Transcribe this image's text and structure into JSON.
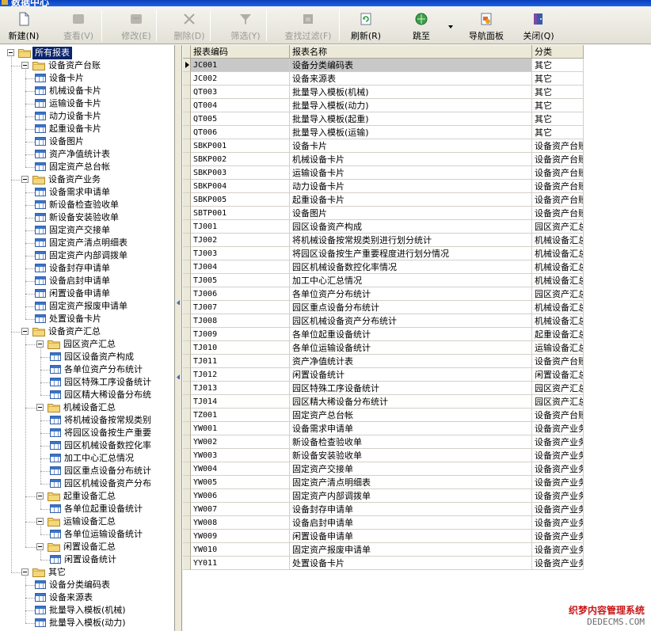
{
  "window": {
    "title": "数据中心"
  },
  "toolbar": {
    "buttons": [
      {
        "label": "新建(N)",
        "icon": "new-document-icon",
        "enabled": true
      },
      {
        "label": "查看(V)",
        "icon": "view-icon",
        "enabled": false
      },
      {
        "label": "修改(E)",
        "icon": "edit-icon",
        "enabled": false
      },
      {
        "label": "删除(D)",
        "icon": "delete-x-icon",
        "enabled": false
      },
      {
        "label": "筛选(Y)",
        "icon": "filter-funnel-icon",
        "enabled": false
      },
      {
        "label": "查找过滤(F)",
        "icon": "find-filter-icon",
        "enabled": false
      },
      {
        "label": "刷新(R)",
        "icon": "refresh-icon",
        "enabled": true
      },
      {
        "label": "跳至",
        "icon": "go-to-globe-icon",
        "enabled": true
      },
      {
        "label": "导航面板",
        "icon": "navigation-panel-icon",
        "enabled": true
      },
      {
        "label": "关闭(Q)",
        "icon": "close-door-icon",
        "enabled": true
      }
    ]
  },
  "tree": {
    "nodes": [
      {
        "label": "所有报表",
        "type": "root",
        "level": 0,
        "selected": true
      },
      {
        "label": "设备资产台账",
        "type": "folder",
        "level": 1
      },
      {
        "label": "设备卡片",
        "type": "report",
        "level": 2
      },
      {
        "label": "机械设备卡片",
        "type": "report",
        "level": 2
      },
      {
        "label": "运输设备卡片",
        "type": "report",
        "level": 2
      },
      {
        "label": "动力设备卡片",
        "type": "report",
        "level": 2
      },
      {
        "label": "起重设备卡片",
        "type": "report",
        "level": 2
      },
      {
        "label": "设备图片",
        "type": "report",
        "level": 2
      },
      {
        "label": "资产净值统计表",
        "type": "report",
        "level": 2
      },
      {
        "label": "固定资产总台帐",
        "type": "report",
        "level": 2
      },
      {
        "label": "设备资产业务",
        "type": "folder",
        "level": 1
      },
      {
        "label": "设备需求申请单",
        "type": "report",
        "level": 2
      },
      {
        "label": "新设备检查验收单",
        "type": "report",
        "level": 2
      },
      {
        "label": "新设备安装验收单",
        "type": "report",
        "level": 2
      },
      {
        "label": "固定资产交接单",
        "type": "report",
        "level": 2
      },
      {
        "label": "固定资产清点明细表",
        "type": "report",
        "level": 2
      },
      {
        "label": "固定资产内部调拨单",
        "type": "report",
        "level": 2
      },
      {
        "label": "设备封存申请单",
        "type": "report",
        "level": 2
      },
      {
        "label": "设备启封申请单",
        "type": "report",
        "level": 2
      },
      {
        "label": "闲置设备申请单",
        "type": "report",
        "level": 2
      },
      {
        "label": "固定资产报废申请单",
        "type": "report",
        "level": 2
      },
      {
        "label": "处置设备卡片",
        "type": "report",
        "level": 2
      },
      {
        "label": "设备资产汇总",
        "type": "folder",
        "level": 1
      },
      {
        "label": "园区资产汇总",
        "type": "folder",
        "level": 2
      },
      {
        "label": "园区设备资产构成",
        "type": "report",
        "level": 3
      },
      {
        "label": "各单位资产分布统计",
        "type": "report",
        "level": 3
      },
      {
        "label": "园区特殊工序设备统计",
        "type": "report",
        "level": 3
      },
      {
        "label": "园区精大稀设备分布统",
        "type": "report",
        "level": 3
      },
      {
        "label": "机械设备汇总",
        "type": "folder",
        "level": 2
      },
      {
        "label": "将机械设备按常规类别",
        "type": "report",
        "level": 3
      },
      {
        "label": "将园区设备按生产重要",
        "type": "report",
        "level": 3
      },
      {
        "label": "园区机械设备数控化率",
        "type": "report",
        "level": 3
      },
      {
        "label": "加工中心汇总情况",
        "type": "report",
        "level": 3
      },
      {
        "label": "园区重点设备分布统计",
        "type": "report",
        "level": 3
      },
      {
        "label": "园区机械设备资产分布",
        "type": "report",
        "level": 3
      },
      {
        "label": "起重设备汇总",
        "type": "folder",
        "level": 2
      },
      {
        "label": "各单位起重设备统计",
        "type": "report",
        "level": 3
      },
      {
        "label": "运输设备汇总",
        "type": "folder",
        "level": 2
      },
      {
        "label": "各单位运输设备统计",
        "type": "report",
        "level": 3
      },
      {
        "label": "闲置设备汇总",
        "type": "folder",
        "level": 2
      },
      {
        "label": "闲置设备统计",
        "type": "report",
        "level": 3
      },
      {
        "label": "其它",
        "type": "folder",
        "level": 1
      },
      {
        "label": "设备分类编码表",
        "type": "report",
        "level": 2
      },
      {
        "label": "设备来源表",
        "type": "report",
        "level": 2
      },
      {
        "label": "批量导入模板(机械)",
        "type": "report",
        "level": 2
      },
      {
        "label": "批量导入模板(动力)",
        "type": "report",
        "level": 2
      }
    ]
  },
  "grid": {
    "columns": [
      "报表编码",
      "报表名称",
      "分类"
    ],
    "rows": [
      {
        "code": "JC001",
        "name": "设备分类编码表",
        "category": "其它",
        "selected": true
      },
      {
        "code": "JC002",
        "name": "设备来源表",
        "category": "其它"
      },
      {
        "code": "QT003",
        "name": "批量导入模板(机械)",
        "category": "其它"
      },
      {
        "code": "QT004",
        "name": "批量导入模板(动力)",
        "category": "其它"
      },
      {
        "code": "QT005",
        "name": "批量导入模板(起重)",
        "category": "其它"
      },
      {
        "code": "QT006",
        "name": "批量导入模板(运输)",
        "category": "其它"
      },
      {
        "code": "SBKP001",
        "name": "设备卡片",
        "category": "设备资产台账"
      },
      {
        "code": "SBKP002",
        "name": "机械设备卡片",
        "category": "设备资产台账"
      },
      {
        "code": "SBKP003",
        "name": "运输设备卡片",
        "category": "设备资产台账"
      },
      {
        "code": "SBKP004",
        "name": "动力设备卡片",
        "category": "设备资产台账"
      },
      {
        "code": "SBKP005",
        "name": "起重设备卡片",
        "category": "设备资产台账"
      },
      {
        "code": "SBTP001",
        "name": "设备图片",
        "category": "设备资产台账"
      },
      {
        "code": "TJ001",
        "name": "园区设备资产构成",
        "category": "园区资产汇总"
      },
      {
        "code": "TJ002",
        "name": "将机械设备按常规类别进行划分统计",
        "category": "机械设备汇总"
      },
      {
        "code": "TJ003",
        "name": "将园区设备按生产重要程度进行划分情况",
        "category": "机械设备汇总"
      },
      {
        "code": "TJ004",
        "name": "园区机械设备数控化率情况",
        "category": "机械设备汇总"
      },
      {
        "code": "TJ005",
        "name": "加工中心汇总情况",
        "category": "机械设备汇总"
      },
      {
        "code": "TJ006",
        "name": "各单位资产分布统计",
        "category": "园区资产汇总"
      },
      {
        "code": "TJ007",
        "name": "园区重点设备分布统计",
        "category": "机械设备汇总"
      },
      {
        "code": "TJ008",
        "name": "园区机械设备资产分布统计",
        "category": "机械设备汇总"
      },
      {
        "code": "TJ009",
        "name": "各单位起重设备统计",
        "category": "起重设备汇总"
      },
      {
        "code": "TJ010",
        "name": "各单位运输设备统计",
        "category": "运输设备汇总"
      },
      {
        "code": "TJ011",
        "name": "资产净值统计表",
        "category": "设备资产台账"
      },
      {
        "code": "TJ012",
        "name": "闲置设备统计",
        "category": "闲置设备汇总"
      },
      {
        "code": "TJ013",
        "name": "园区特殊工序设备统计",
        "category": "园区资产汇总"
      },
      {
        "code": "TJ014",
        "name": "园区精大稀设备分布统计",
        "category": "园区资产汇总"
      },
      {
        "code": "TZ001",
        "name": "固定资产总台帐",
        "category": "设备资产台账"
      },
      {
        "code": "YW001",
        "name": "设备需求申请单",
        "category": "设备资产业务"
      },
      {
        "code": "YW002",
        "name": "新设备检查验收单",
        "category": "设备资产业务"
      },
      {
        "code": "YW003",
        "name": "新设备安装验收单",
        "category": "设备资产业务"
      },
      {
        "code": "YW004",
        "name": "固定资产交接单",
        "category": "设备资产业务"
      },
      {
        "code": "YW005",
        "name": "固定资产清点明细表",
        "category": "设备资产业务"
      },
      {
        "code": "YW006",
        "name": "固定资产内部调拨单",
        "category": "设备资产业务"
      },
      {
        "code": "YW007",
        "name": "设备封存申请单",
        "category": "设备资产业务"
      },
      {
        "code": "YW008",
        "name": "设备启封申请单",
        "category": "设备资产业务"
      },
      {
        "code": "YW009",
        "name": "闲置设备申请单",
        "category": "设备资产业务"
      },
      {
        "code": "YW010",
        "name": "固定资产报废申请单",
        "category": "设备资产业务"
      },
      {
        "code": "YY011",
        "name": "处置设备卡片",
        "category": "设备资产业务"
      }
    ]
  },
  "watermark": {
    "line1": "织梦内容管理系统",
    "line2": "DEDECMS.COM"
  },
  "colors": {
    "selection": "#0a246a",
    "row_highlight": "#c8c8c8",
    "header_bg": "#ece9d8",
    "titlebar": "#1c62e6"
  }
}
